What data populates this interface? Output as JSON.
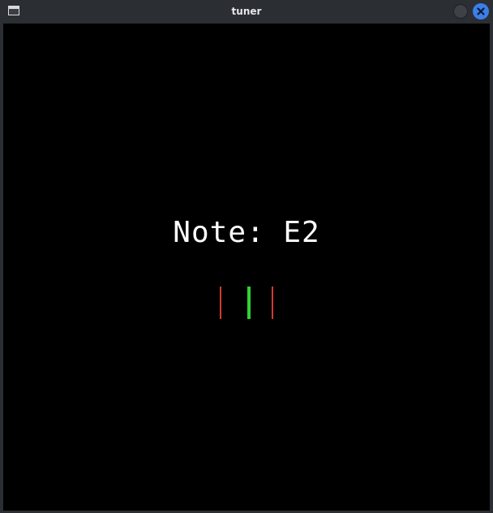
{
  "window": {
    "title": "tuner"
  },
  "tuner": {
    "note_label": "Note: E2",
    "indicator": {
      "flat_color": "#d33a34",
      "in_tune_color": "#2fd331",
      "sharp_color": "#d33a34"
    }
  },
  "icons": {
    "app": "window-icon",
    "minimize": "minimize-icon",
    "close": "close-icon"
  }
}
